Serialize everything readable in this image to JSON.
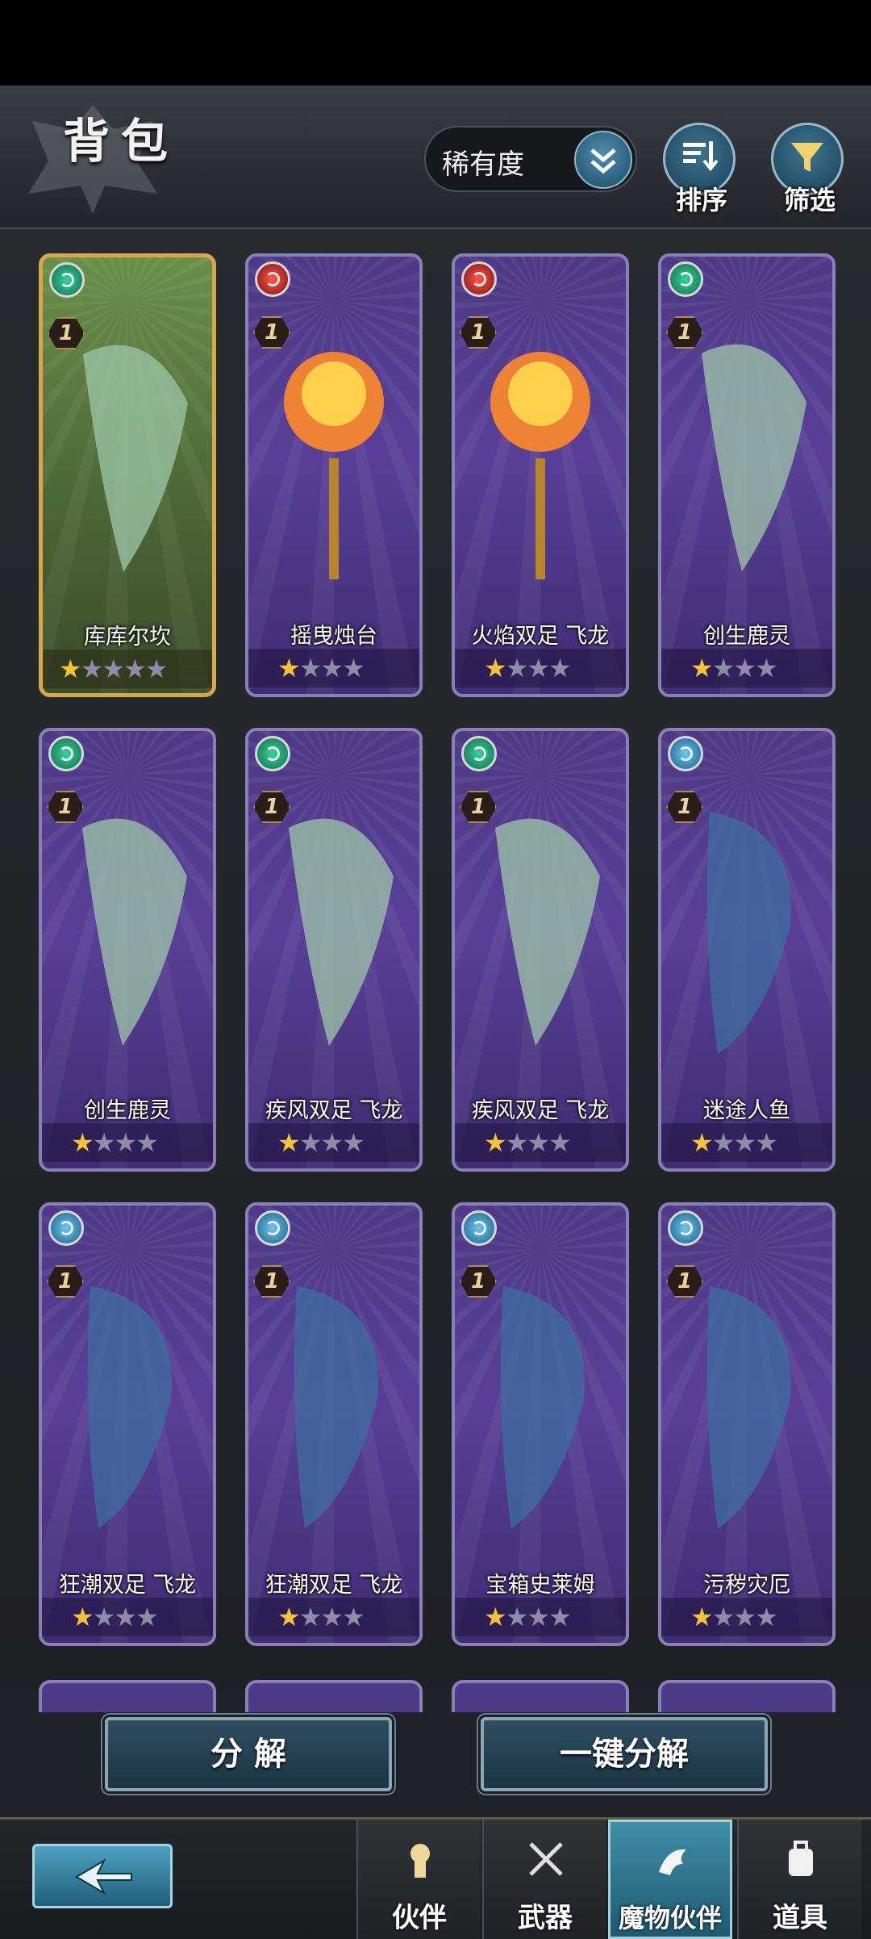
{
  "header": {
    "title": "背包",
    "sort_value": "稀有度",
    "sort_button_label": "排序",
    "filter_button_label": "筛选"
  },
  "cards": [
    {
      "name": "库库尔坎",
      "element": "wind",
      "level": "1",
      "stars_filled": 1,
      "stars_total": 5,
      "highlight": true
    },
    {
      "name": "摇曳烛台",
      "element": "fire",
      "level": "1",
      "stars_filled": 1,
      "stars_total": 4
    },
    {
      "name": "火焰双足 飞龙",
      "element": "fire",
      "level": "1",
      "stars_filled": 1,
      "stars_total": 4
    },
    {
      "name": "创生鹿灵",
      "element": "wind",
      "level": "1",
      "stars_filled": 1,
      "stars_total": 4
    },
    {
      "name": "创生鹿灵",
      "element": "wind",
      "level": "1",
      "stars_filled": 1,
      "stars_total": 4
    },
    {
      "name": "疾风双足 飞龙",
      "element": "wind",
      "level": "1",
      "stars_filled": 1,
      "stars_total": 4
    },
    {
      "name": "疾风双足 飞龙",
      "element": "wind",
      "level": "1",
      "stars_filled": 1,
      "stars_total": 4
    },
    {
      "name": "迷途人鱼",
      "element": "water",
      "level": "1",
      "stars_filled": 1,
      "stars_total": 4
    },
    {
      "name": "狂潮双足 飞龙",
      "element": "water",
      "level": "1",
      "stars_filled": 1,
      "stars_total": 4
    },
    {
      "name": "狂潮双足 飞龙",
      "element": "water",
      "level": "1",
      "stars_filled": 1,
      "stars_total": 4
    },
    {
      "name": "宝箱史莱姆",
      "element": "water",
      "level": "1",
      "stars_filled": 1,
      "stars_total": 4
    },
    {
      "name": "污秽灾厄",
      "element": "water",
      "level": "1",
      "stars_filled": 1,
      "stars_total": 4
    }
  ],
  "actions": {
    "decompose": "分 解",
    "one_click_decompose": "一键分解"
  },
  "nav": {
    "tabs": [
      {
        "label": "伙伴",
        "icon": "head-icon"
      },
      {
        "label": "武器",
        "icon": "crossed-swords-icon"
      },
      {
        "label": "魔物伙伴",
        "icon": "dragon-icon",
        "active": true
      },
      {
        "label": "道具",
        "icon": "backpack-icon"
      }
    ]
  },
  "colors": {
    "card_purple": "#5a3f98",
    "gold_frame": "#d9a648",
    "star_on": "#f3c433",
    "accent_teal": "#3f8fa8"
  }
}
